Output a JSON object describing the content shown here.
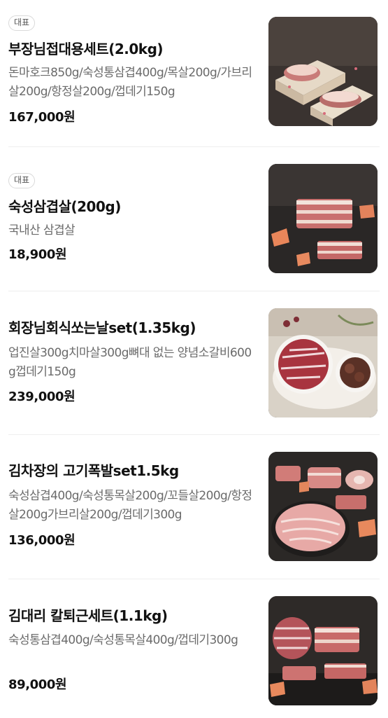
{
  "menu": {
    "items": [
      {
        "badge": "대표",
        "name": "부장님접대용세트(2.0kg)",
        "description": "돈마호크850g/숙성통삼겹400g/목살200g/가브리살200g/항정살200g/껍데기150g",
        "price": "167,000원",
        "image": "pork-gift-box-photo"
      },
      {
        "badge": "대표",
        "name": "숙성삼겹살(200g)",
        "description": "국내산 삼겹살",
        "price": "18,900원",
        "image": "pork-belly-slab-photo"
      },
      {
        "badge": "",
        "name": "회장님회식쏘는날set(1.35kg)",
        "description": "업진살300g치마살300g뼈대 없는 양념소갈비600g껍데기150g",
        "price": "239,000원",
        "image": "beef-platter-photo"
      },
      {
        "badge": "",
        "name": "김차장의 고기폭발set1.5kg",
        "description": "숙성삼겹400g/숙성통목살200g/꼬들살200g/항정살200g가브리살200g/껍데기300g",
        "price": "136,000원",
        "image": "pork-assortment-platter-photo"
      },
      {
        "badge": "",
        "name": "김대리 칼퇴근세트(1.1kg)",
        "description": "숙성통삼겹400g/숙성통목살400g/껍데기300g",
        "price": "89,000원",
        "image": "pork-set-board-photo"
      }
    ]
  },
  "colors": {
    "text_primary": "#111111",
    "text_secondary": "#6b6b6b",
    "badge_border": "#d9d9d9",
    "divider": "#eeeeee"
  }
}
